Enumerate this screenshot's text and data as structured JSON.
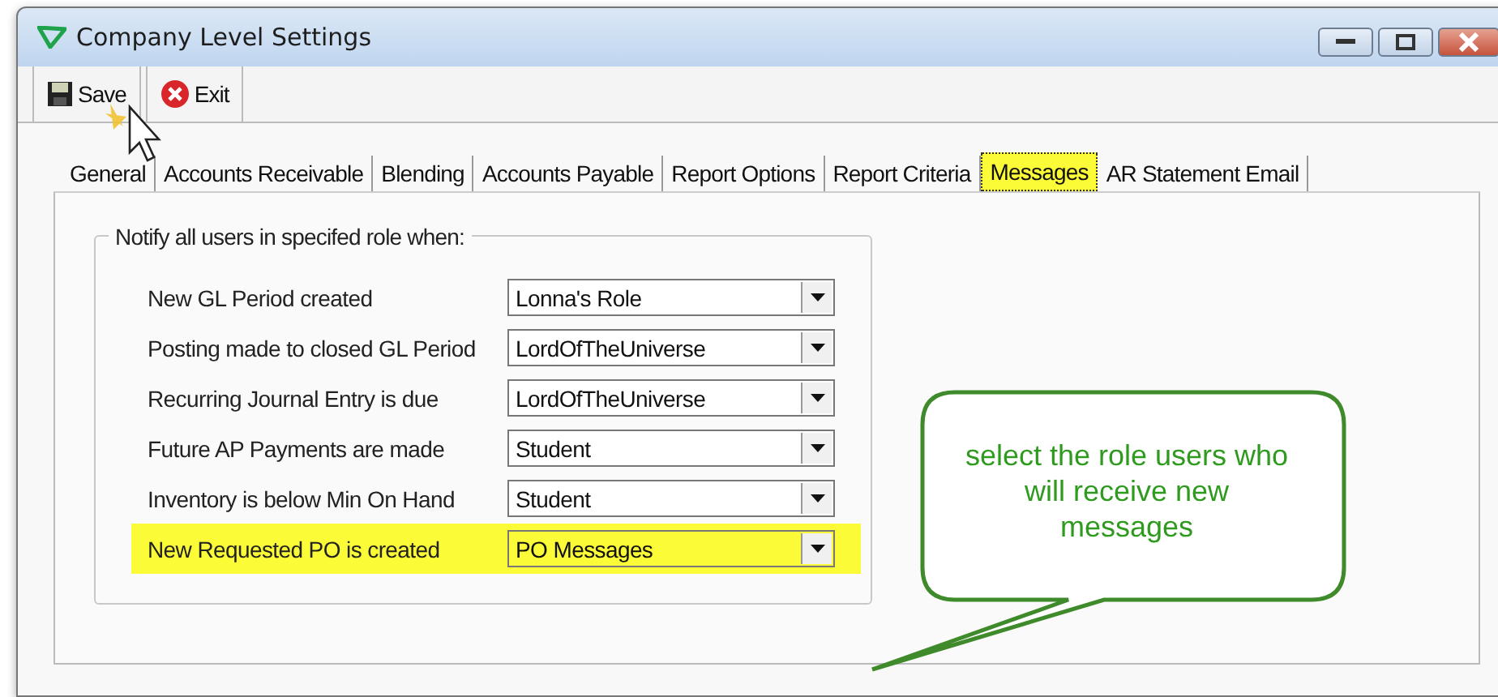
{
  "window": {
    "title": "Company Level Settings"
  },
  "toolbar": [
    {
      "kind": "save",
      "label": "Save"
    },
    {
      "kind": "exit",
      "label": "Exit"
    }
  ],
  "tabs": [
    {
      "label": "General",
      "selected": false,
      "highlighted": false
    },
    {
      "label": "Accounts Receivable",
      "selected": false,
      "highlighted": false
    },
    {
      "label": "Blending",
      "selected": false,
      "highlighted": false
    },
    {
      "label": "Accounts Payable",
      "selected": false,
      "highlighted": false
    },
    {
      "label": "Report Options",
      "selected": false,
      "highlighted": false
    },
    {
      "label": "Report Criteria",
      "selected": false,
      "highlighted": false
    },
    {
      "label": "Messages",
      "selected": true,
      "highlighted": true
    },
    {
      "label": "AR Statement Email",
      "selected": false,
      "highlighted": false
    }
  ],
  "group": {
    "title": "Notify all users in specifed role when:",
    "rows": [
      {
        "label": "New GL Period created",
        "value": "Lonna's Role",
        "highlighted": false
      },
      {
        "label": "Posting made to closed GL Period",
        "value": "LordOfTheUniverse",
        "highlighted": false
      },
      {
        "label": "Recurring Journal Entry is due",
        "value": "LordOfTheUniverse",
        "highlighted": false
      },
      {
        "label": "Future AP Payments are made",
        "value": "Student",
        "highlighted": false
      },
      {
        "label": "Inventory is below Min On Hand",
        "value": "Student",
        "highlighted": false
      },
      {
        "label": "New Requested PO is created",
        "value": "PO Messages",
        "highlighted": true
      }
    ]
  },
  "callout": {
    "text": "select the role users who will receive new messages"
  }
}
